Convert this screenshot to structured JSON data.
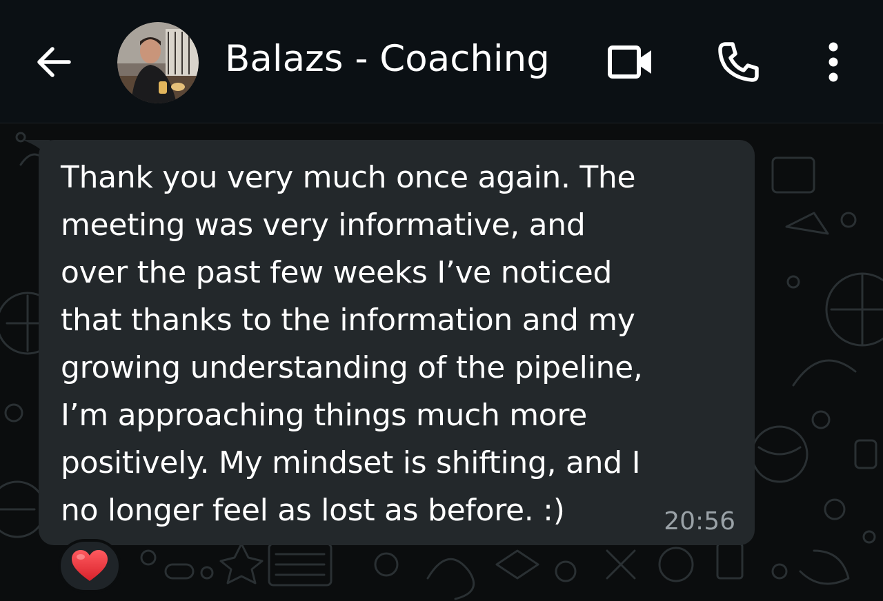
{
  "header": {
    "contact_name": "Balazs - Coaching",
    "back_icon": "arrow-left-icon",
    "video_icon": "video-camera-icon",
    "call_icon": "phone-icon",
    "menu_icon": "more-vertical-icon"
  },
  "message": {
    "text": "Thank you very much once again. The\nmeeting was very informative, and\nover the past few weeks I’ve noticed\nthat thanks to the information and my\ngrowing understanding of the pipeline,\nI’m approaching things much more\npositively. My mindset is shifting, and I\nno longer feel as lost as before. :)",
    "time": "20:56",
    "reaction_icon": "red-heart-icon"
  },
  "colors": {
    "background": "#0b0d0e",
    "header": "#0b1014",
    "bubble": "#23282b",
    "text": "#ffffff",
    "timestamp": "#9aa2a7",
    "heart": "#e8343c"
  }
}
